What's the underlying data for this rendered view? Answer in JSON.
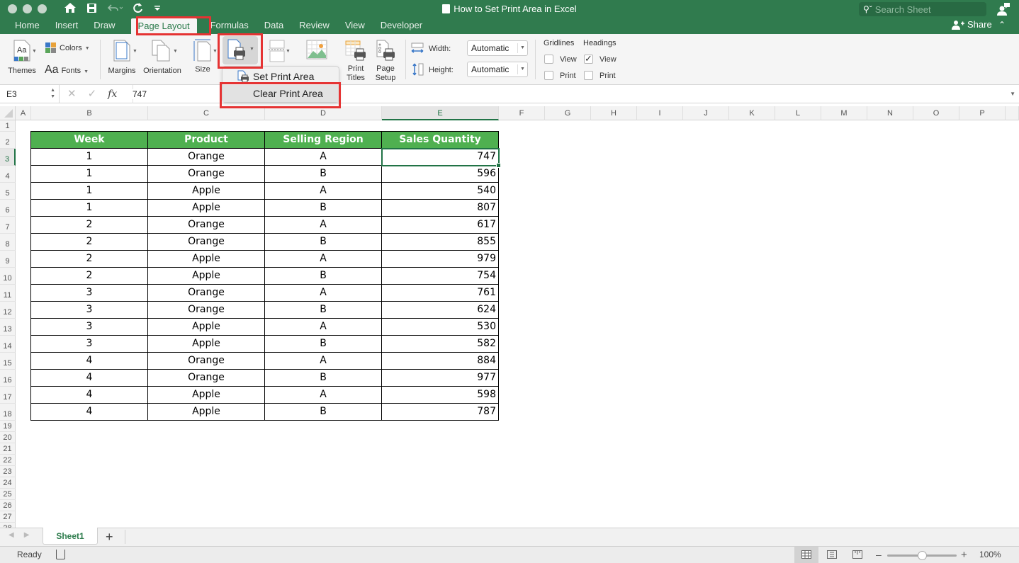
{
  "window": {
    "title": "How to Set Print Area in Excel",
    "search_placeholder": "Search Sheet"
  },
  "quick_access": [
    "home-icon",
    "save-icon",
    "undo-icon",
    "redo-icon",
    "customize-icon"
  ],
  "tabs": [
    {
      "label": "Home"
    },
    {
      "label": "Insert"
    },
    {
      "label": "Draw"
    },
    {
      "label": "Page Layout",
      "active": true
    },
    {
      "label": "Formulas"
    },
    {
      "label": "Data"
    },
    {
      "label": "Review"
    },
    {
      "label": "View"
    },
    {
      "label": "Developer"
    }
  ],
  "share_label": "Share",
  "ribbon": {
    "themes_label": "Themes",
    "colors_label": "Colors",
    "fonts_label": "Fonts",
    "margins_label": "Margins",
    "orientation_label": "Orientation",
    "size_label": "Size",
    "print_titles_label_1": "Print",
    "print_titles_label_2": "Titles",
    "page_setup_label_1": "Page",
    "page_setup_label_2": "Setup",
    "width_label": "Width:",
    "width_value": "Automatic",
    "height_label": "Height:",
    "height_value": "Automatic",
    "gridlines_label": "Gridlines",
    "headings_label": "Headings",
    "view_label": "View",
    "print_label": "Print",
    "gridlines_view": false,
    "gridlines_print": false,
    "headings_view": true,
    "headings_print": false
  },
  "print_area_menu": {
    "items": [
      {
        "label": "Set Print Area"
      },
      {
        "label": "Clear Print Area",
        "highlighted": true
      }
    ]
  },
  "formula_bar": {
    "name_box": "E3",
    "value": "747",
    "fx_label": "fx"
  },
  "grid": {
    "columns": [
      "A",
      "B",
      "C",
      "D",
      "E",
      "F",
      "G",
      "H",
      "I",
      "J",
      "K",
      "L",
      "M",
      "N",
      "O",
      "P"
    ],
    "selected_column": "E",
    "selected_row": 3,
    "row_count": 28,
    "table": {
      "headers": [
        "Week",
        "Product",
        "Selling Region",
        "Sales Quantity"
      ],
      "rows": [
        [
          "1",
          "Orange",
          "A",
          "747"
        ],
        [
          "1",
          "Orange",
          "B",
          "596"
        ],
        [
          "1",
          "Apple",
          "A",
          "540"
        ],
        [
          "1",
          "Apple",
          "B",
          "807"
        ],
        [
          "2",
          "Orange",
          "A",
          "617"
        ],
        [
          "2",
          "Orange",
          "B",
          "855"
        ],
        [
          "2",
          "Apple",
          "A",
          "979"
        ],
        [
          "2",
          "Apple",
          "B",
          "754"
        ],
        [
          "3",
          "Orange",
          "A",
          "761"
        ],
        [
          "3",
          "Orange",
          "B",
          "624"
        ],
        [
          "3",
          "Apple",
          "A",
          "530"
        ],
        [
          "3",
          "Apple",
          "B",
          "582"
        ],
        [
          "4",
          "Orange",
          "A",
          "884"
        ],
        [
          "4",
          "Orange",
          "B",
          "977"
        ],
        [
          "4",
          "Apple",
          "A",
          "598"
        ],
        [
          "4",
          "Apple",
          "B",
          "787"
        ]
      ]
    }
  },
  "sheets": [
    {
      "label": "Sheet1",
      "active": true
    }
  ],
  "status": {
    "ready": "Ready",
    "zoom": "100%",
    "zoom_fraction": 0.5
  },
  "colors": {
    "titlebar": "#307b4e",
    "table_header": "#4fb050",
    "highlight": "#e53333",
    "selection": "#217346"
  }
}
